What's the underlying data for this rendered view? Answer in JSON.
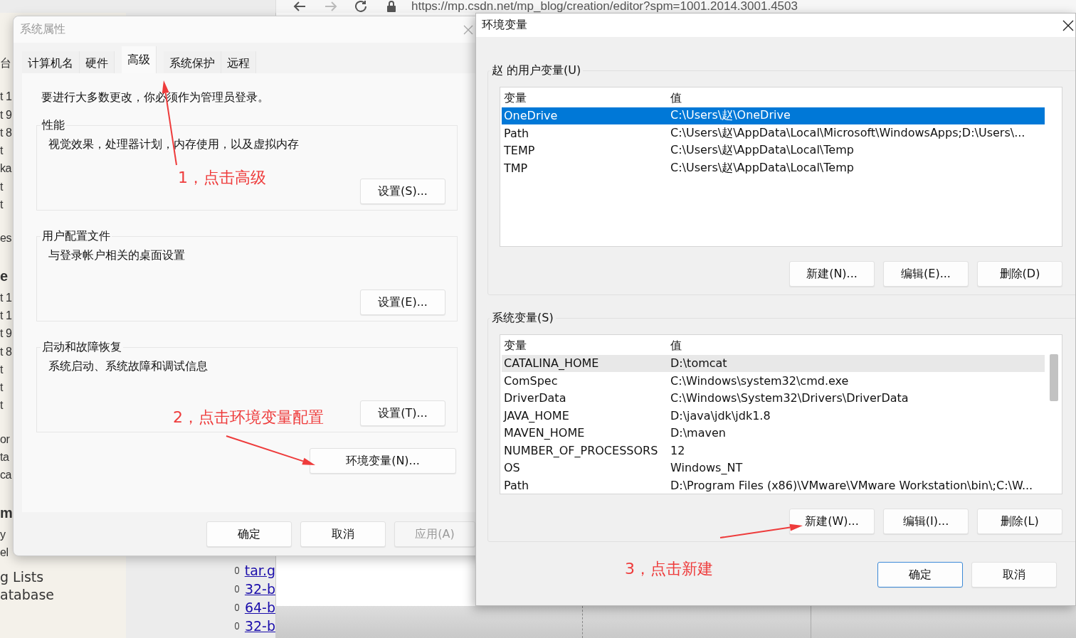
{
  "browser": {
    "url": "https://mp.csdn.net/mp_blog/creation/editor?spm=1001.2014.3001.4503",
    "left_fragments": [
      [
        {
          "text": "台",
          "kind": "text"
        }
      ],
      [
        {
          "text": "t 1",
          "kind": "text"
        },
        {
          "text": "t 9",
          "kind": "text"
        },
        {
          "text": "t 8",
          "kind": "text"
        },
        {
          "text": "t",
          "kind": "text"
        },
        {
          "text": "ka",
          "kind": "text"
        },
        {
          "text": "t",
          "kind": "text"
        },
        {
          "text": "t",
          "kind": "text"
        }
      ],
      [
        {
          "text": "es",
          "kind": "text"
        }
      ],
      [
        {
          "text": "e",
          "kind": "heading"
        },
        {
          "text": "t 1",
          "kind": "text"
        },
        {
          "text": "t 1",
          "kind": "text"
        },
        {
          "text": "t 9",
          "kind": "text"
        },
        {
          "text": "t 8",
          "kind": "text"
        },
        {
          "text": "t",
          "kind": "text"
        },
        {
          "text": "t",
          "kind": "text"
        },
        {
          "text": "t",
          "kind": "text"
        }
      ],
      [
        {
          "text": "or",
          "kind": "text"
        },
        {
          "text": "ta",
          "kind": "text"
        },
        {
          "text": "ca",
          "kind": "text"
        }
      ],
      [
        {
          "text": "m",
          "kind": "heading"
        },
        {
          "text": "y",
          "kind": "text"
        },
        {
          "text": "el",
          "kind": "text"
        }
      ]
    ],
    "bottom_left": [
      "g Lists",
      "atabase"
    ],
    "links": [
      "tar.g",
      "32-b",
      "64-b",
      "32-b"
    ]
  },
  "system_properties": {
    "title": "系统属性",
    "tabs": [
      {
        "label": "计算机名",
        "selected": false
      },
      {
        "label": "硬件",
        "selected": false
      },
      {
        "label": "高级",
        "selected": true
      },
      {
        "label": "系统保护",
        "selected": false
      },
      {
        "label": "远程",
        "selected": false
      }
    ],
    "notice": "要进行大多数更改，你必须作为管理员登录。",
    "groups": [
      {
        "title": "性能",
        "description": "视觉效果，处理器计划，内存使用，以及虚拟内存",
        "button": "设置(S)..."
      },
      {
        "title": "用户配置文件",
        "description": "与登录帐户相关的桌面设置",
        "button": "设置(E)..."
      },
      {
        "title": "启动和故障恢复",
        "description": "系统启动、系统故障和调试信息",
        "button": "设置(T)..."
      }
    ],
    "env_button": "环境变量(N)...",
    "buttons": [
      {
        "label": "确定",
        "disabled": false
      },
      {
        "label": "取消",
        "disabled": false
      },
      {
        "label": "应用(A)",
        "disabled": true
      }
    ]
  },
  "environment_variables": {
    "title": "环境变量",
    "user_vars": {
      "title": "赵 的用户变量(U)",
      "columns": [
        "变量",
        "值"
      ],
      "rows": [
        {
          "name": "OneDrive",
          "value": "C:\\Users\\赵\\OneDrive",
          "selected": true,
          "hovered": false
        },
        {
          "name": "Path",
          "value": "C:\\Users\\赵\\AppData\\Local\\Microsoft\\WindowsApps;D:\\Users\\...",
          "selected": false,
          "hovered": false
        },
        {
          "name": "TEMP",
          "value": "C:\\Users\\赵\\AppData\\Local\\Temp",
          "selected": false,
          "hovered": false
        },
        {
          "name": "TMP",
          "value": "C:\\Users\\赵\\AppData\\Local\\Temp",
          "selected": false,
          "hovered": false
        }
      ],
      "scrollbar": false,
      "buttons": [
        "新建(N)...",
        "编辑(E)...",
        "删除(D)"
      ]
    },
    "system_vars": {
      "title": "系统变量(S)",
      "columns": [
        "变量",
        "值"
      ],
      "rows": [
        {
          "name": "CATALINA_HOME",
          "value": "D:\\tomcat",
          "selected": false,
          "hovered": true
        },
        {
          "name": "ComSpec",
          "value": "C:\\Windows\\system32\\cmd.exe",
          "selected": false,
          "hovered": false
        },
        {
          "name": "DriverData",
          "value": "C:\\Windows\\System32\\Drivers\\DriverData",
          "selected": false,
          "hovered": false
        },
        {
          "name": "JAVA_HOME",
          "value": "D:\\java\\jdk\\jdk1.8",
          "selected": false,
          "hovered": false
        },
        {
          "name": "MAVEN_HOME",
          "value": "D:\\maven",
          "selected": false,
          "hovered": false
        },
        {
          "name": "NUMBER_OF_PROCESSORS",
          "value": "12",
          "selected": false,
          "hovered": false
        },
        {
          "name": "OS",
          "value": "Windows_NT",
          "selected": false,
          "hovered": false
        },
        {
          "name": "Path",
          "value": "D:\\Program Files (x86)\\VMware\\VMware Workstation\\bin\\;C:\\W...",
          "selected": false,
          "hovered": false
        }
      ],
      "scrollbar": true,
      "buttons": [
        "新建(W)...",
        "编辑(I)...",
        "删除(L)"
      ]
    },
    "buttons": [
      {
        "label": "确定",
        "default": true
      },
      {
        "label": "取消",
        "default": false
      }
    ]
  },
  "annotations": [
    {
      "text": "1，点击高级"
    },
    {
      "text": "2，点击环境变量配置"
    },
    {
      "text": "3，点击新建"
    }
  ]
}
